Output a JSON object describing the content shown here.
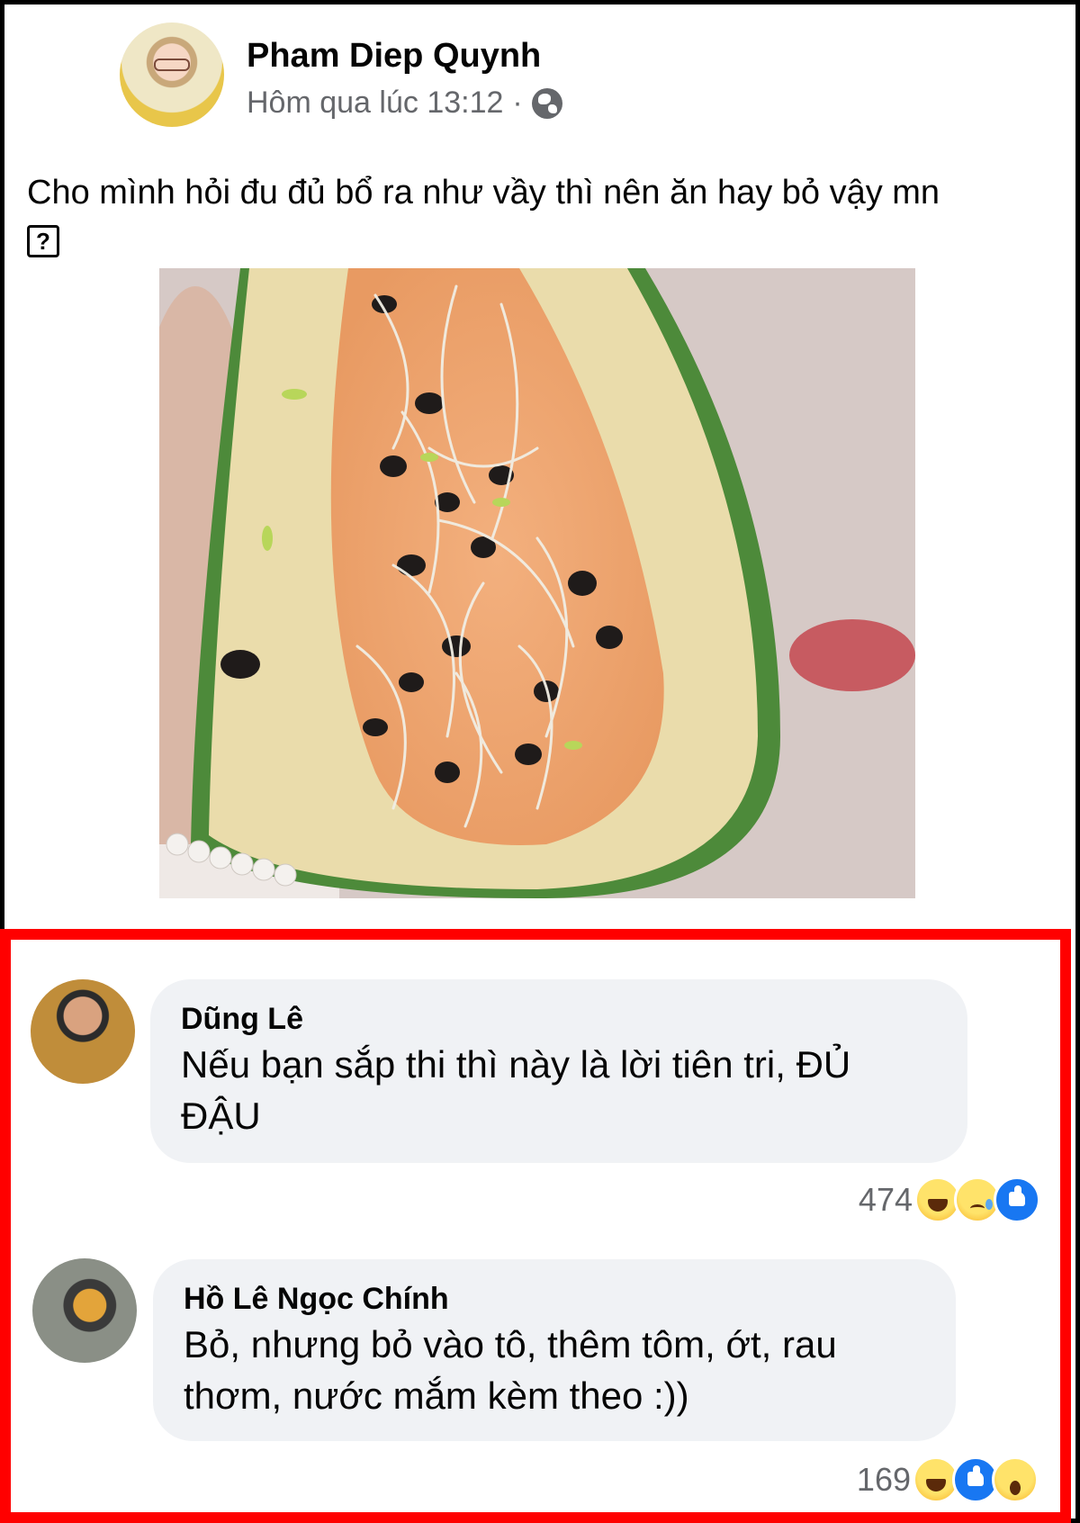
{
  "post": {
    "author": "Pham Diep Quynh",
    "timestamp": "Hôm qua lúc 13:12",
    "separator": "·",
    "audience_icon": "globe-icon",
    "text": "Cho mình hỏi đu đủ bổ ra như vầy thì nên ăn hay bỏ vậy mn",
    "text_emoji": "?"
  },
  "comments": [
    {
      "author": "Dũng Lê",
      "text": "Nếu bạn sắp thi thì này là lời tiên tri, ĐỦ ĐẬU",
      "reaction_count": "474",
      "reactions": [
        "haha",
        "sad",
        "like"
      ]
    },
    {
      "author": "Hồ Lê Ngọc Chính",
      "text": "Bỏ, nhưng bỏ vào tô, thêm tôm, ớt, rau thơm, nước mắm kèm theo :))",
      "reaction_count": "169",
      "reactions": [
        "haha",
        "like",
        "wow"
      ]
    }
  ],
  "colors": {
    "highlight_border": "#ff0000",
    "bubble_bg": "#f0f2f5",
    "meta_text": "#65676b",
    "like_blue": "#1877f2"
  }
}
